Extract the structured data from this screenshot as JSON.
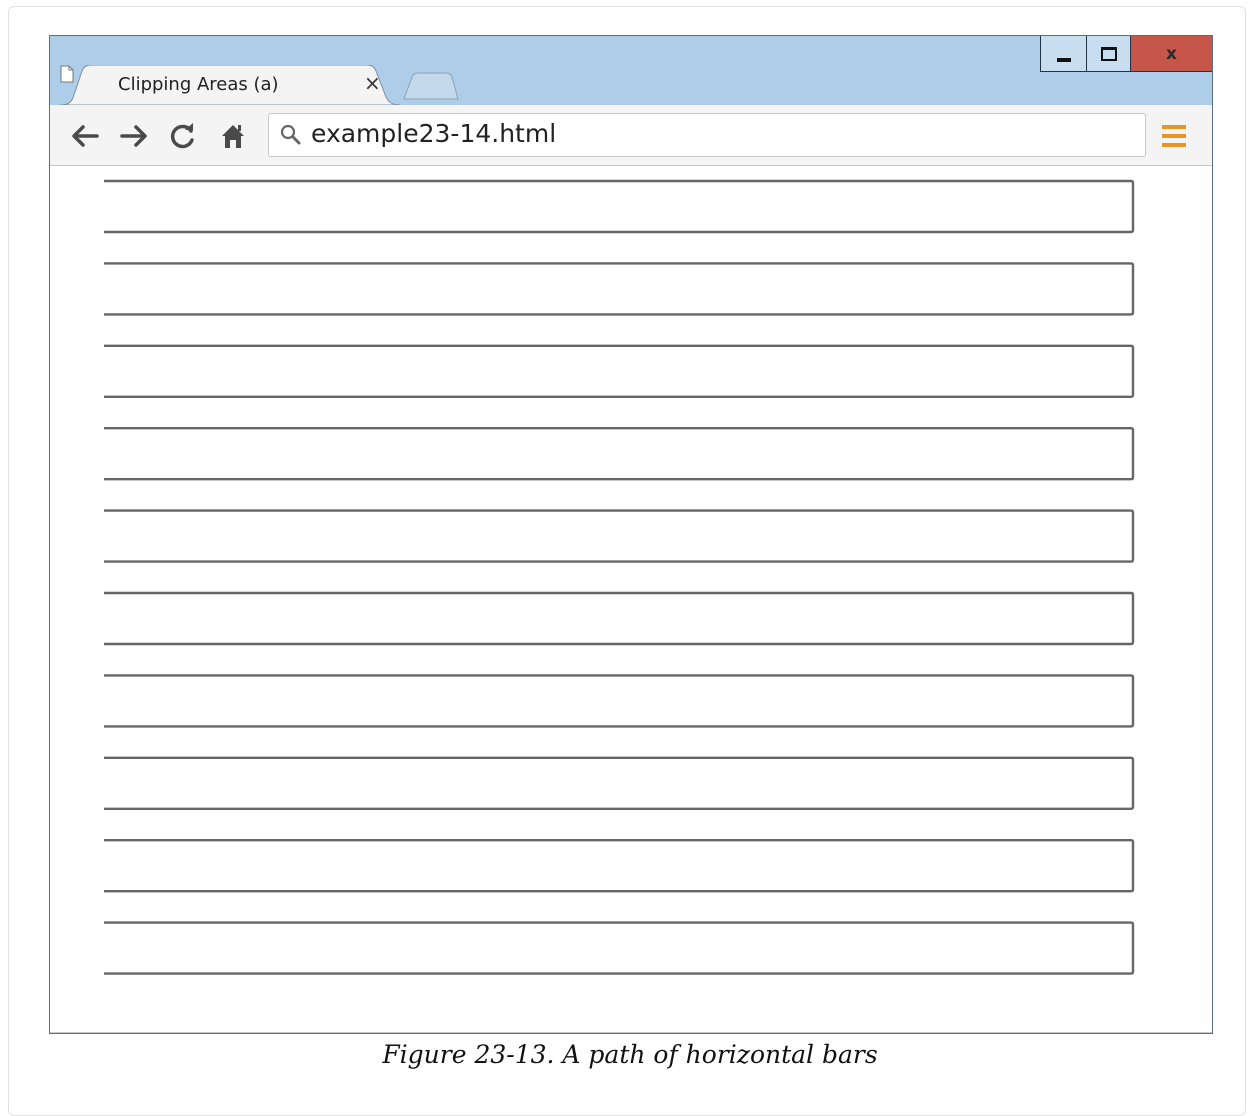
{
  "window": {
    "tab_title": "Clipping Areas (a)",
    "tab_close_glyph": "×",
    "close_glyph": "x"
  },
  "toolbar": {
    "url": "example23-14.html",
    "icons": {
      "back": "back-arrow-icon",
      "forward": "forward-arrow-icon",
      "reload": "reload-icon",
      "home": "home-icon",
      "search": "search-icon",
      "menu": "menu-icon",
      "page": "page-icon"
    }
  },
  "content": {
    "bar_count": 10,
    "bar_style": "rectangle open on left side",
    "stroke_color": "#666666"
  },
  "colors": {
    "titlebar": "#aecde8",
    "close_button": "#c7564a",
    "menu_accent": "#e8952a"
  },
  "caption": "Figure 23-13. A path of horizontal bars"
}
